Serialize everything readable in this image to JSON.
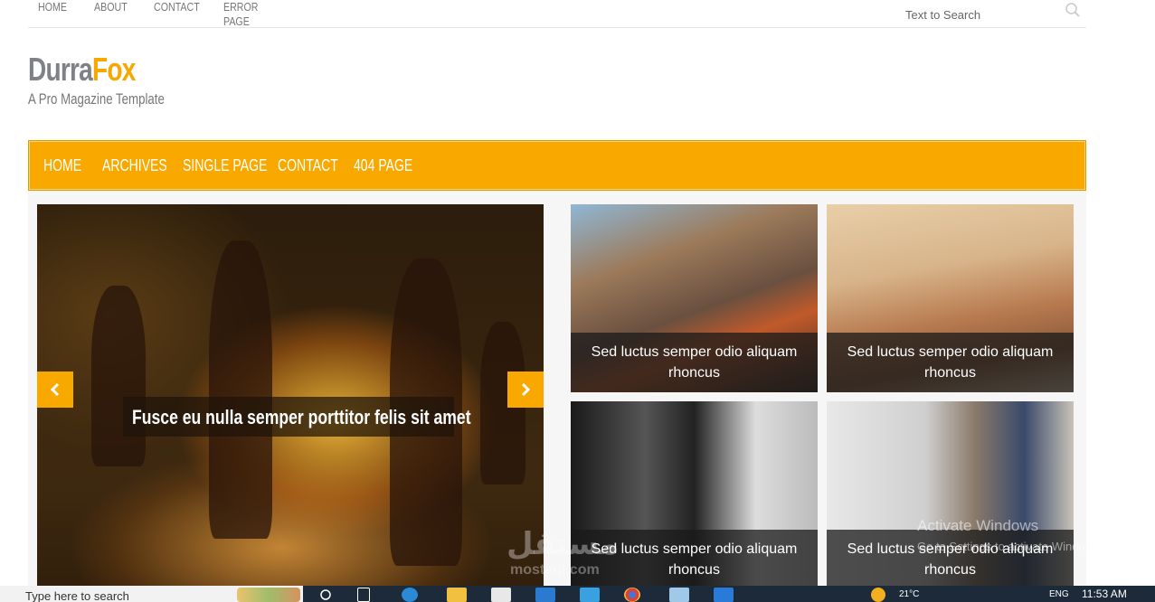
{
  "topnav": {
    "items": [
      "HOME",
      "ABOUT",
      "CONTACT",
      "ERROR PAGE"
    ]
  },
  "search": {
    "placeholder": "Text to Search",
    "icon": "search-icon"
  },
  "logo": {
    "part1": "Durra",
    "part2": "Fox",
    "tagline": "A Pro Magazine Template",
    "color_part1": "#7d8287",
    "color_part2": "#f7a800"
  },
  "mainnav": {
    "bg_color": "#f9a800",
    "items": [
      "HOME",
      "ARCHIVES",
      "SINGLE PAGE",
      "CONTACT",
      "404 PAGE"
    ]
  },
  "slider": {
    "caption": "Fusce eu nulla semper porttitor felis sit amet",
    "prev_icon": "chevron-left-icon",
    "next_icon": "chevron-right-icon"
  },
  "posts": [
    {
      "caption": "Sed luctus semper odio aliquam rhoncus"
    },
    {
      "caption": "Sed luctus semper odio aliquam rhoncus"
    },
    {
      "caption": "Sed luctus semper odio aliquam rhoncus"
    },
    {
      "caption": "Sed luctus semper odio aliquam rhoncus"
    }
  ],
  "watermark": {
    "activate_title": "Activate Windows",
    "activate_sub": "Go to Settings to activate Windows.",
    "mostaql_ar": "مستقل",
    "mostaql_en": "mostaql.com"
  },
  "taskbar": {
    "search_text": "Type here to search",
    "temp": "21°C",
    "lang": "ENG",
    "time": "11:53 AM"
  }
}
